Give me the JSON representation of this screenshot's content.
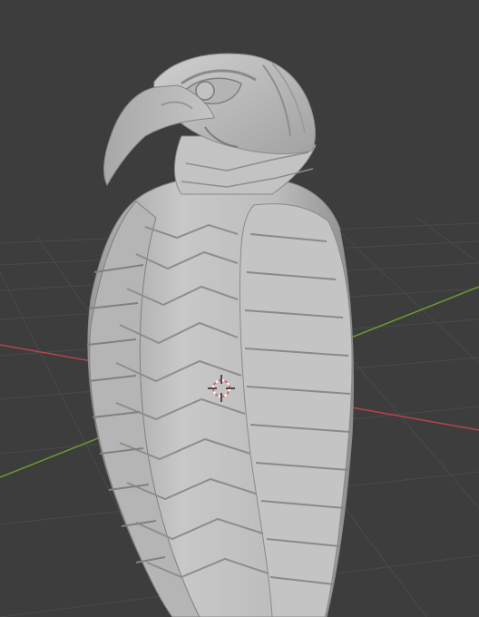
{
  "viewport": {
    "background": "#3d3d3d",
    "grid_color": "#4a4a4a",
    "x_axis_color": "#b8434e",
    "y_axis_color": "#6f9a2e",
    "model_light": "#c9c9c9",
    "model_mid": "#aaaaaa",
    "model_dark": "#7a7a7a",
    "cursor_color": "#d86a6a"
  },
  "objects": {
    "model": "bird-sculpture",
    "cursor": "3d-cursor-icon"
  }
}
